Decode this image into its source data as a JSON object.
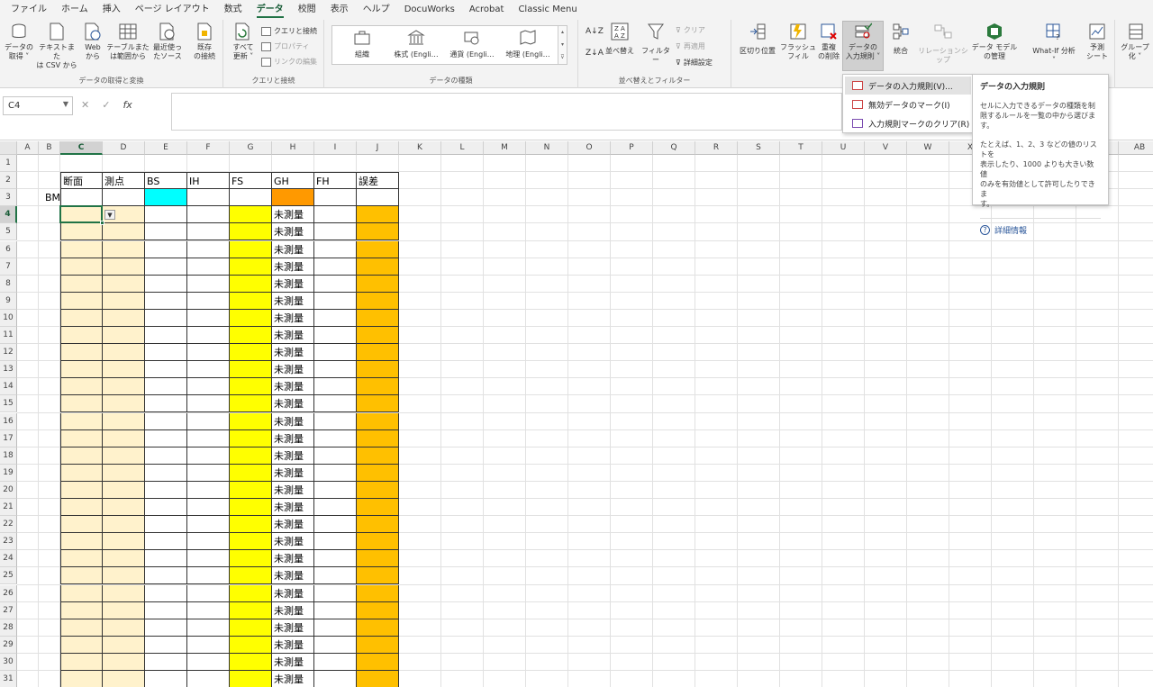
{
  "colors": {
    "accent": "#217346",
    "cyan": "#00ffff",
    "orange_hdr": "#ff9900",
    "peach": "#fff2cc",
    "yellow": "#ffff00",
    "gold": "#ffc000"
  },
  "tabs": [
    "ファイル",
    "ホーム",
    "挿入",
    "ページ レイアウト",
    "数式",
    "データ",
    "校閲",
    "表示",
    "ヘルプ",
    "DocuWorks",
    "Acrobat",
    "Classic Menu"
  ],
  "ribbon": {
    "get_data": {
      "label": "データの取得と変換",
      "buttons": [
        "データの\n取得 ˅",
        "テキストまた\nは CSV から",
        "Web\nから",
        "テーブルまた\nは範囲から",
        "最近使っ\nたソース",
        "既存\nの接続"
      ]
    },
    "queries": {
      "label": "クエリと接続",
      "refresh": "すべて\n更新 ˅",
      "items": [
        "クエリと接続",
        "プロパティ",
        "リンクの編集"
      ]
    },
    "data_types": {
      "label": "データの種類",
      "items": [
        "組織",
        "株式 (Engli…",
        "通貨 (Engli…",
        "地理 (Engli…"
      ]
    },
    "sort_filter": {
      "label": "並べ替えとフィルター",
      "sort": "並べ替え",
      "filter": "フィルター",
      "items": [
        "クリア",
        "再適用",
        "詳細設定"
      ]
    },
    "tools": {
      "split": "区切り位置",
      "flash": "フラッシュ\nフィル",
      "dup": "重複\nの削除",
      "validation": "データの\n入力規則 ˅",
      "consolidate": "統合",
      "relations": "リレーションシップ",
      "model": "データ モデル\nの管理"
    },
    "forecast": {
      "whatif": "What-If 分析\n˅",
      "sheet": "予測\nシート",
      "group": "グループ\n化 ˅"
    }
  },
  "formula_bar": {
    "name_box": "C4",
    "fx": "fx"
  },
  "grid": {
    "columns": [
      "A",
      "B",
      "C",
      "D",
      "E",
      "F",
      "G",
      "H",
      "I",
      "J",
      "K",
      "L",
      "M",
      "N",
      "O",
      "P",
      "Q",
      "R",
      "S",
      "T",
      "U",
      "V",
      "W",
      "X",
      "Y",
      "Z",
      "AA",
      "AB"
    ],
    "rows": [
      "1",
      "2",
      "3",
      "4",
      "5",
      "6",
      "7",
      "8",
      "9",
      "10",
      "11",
      "12",
      "13",
      "14",
      "15",
      "16",
      "17",
      "18",
      "19",
      "20",
      "21",
      "22",
      "23",
      "24",
      "25",
      "26",
      "27",
      "28",
      "29",
      "30",
      "31"
    ],
    "headers": [
      "断面",
      "測点",
      "BS",
      "IH",
      "FS",
      "GH",
      "FH",
      "誤差"
    ],
    "bm_label": "BM",
    "gh_value": "未測量"
  },
  "menu": {
    "items": [
      "データの入力規則(V)...",
      "無効データのマーク(I)",
      "入力規則マークのクリア(R)"
    ]
  },
  "tooltip": {
    "title": "データの入力規則",
    "body1": "セルに入力できるデータの種類を制\n限するルールを一覧の中から選びま\nす。",
    "body2": "たとえば、1、2、3 などの値のリストを\n表示したり、1000 よりも大きい数値\nのみを有効値として許可したりできま\nす。",
    "link": "詳細情報"
  }
}
